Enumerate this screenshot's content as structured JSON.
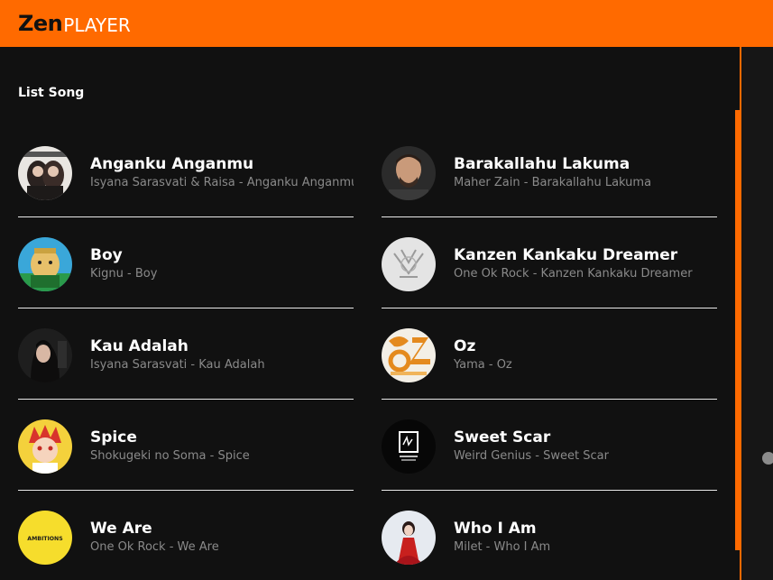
{
  "app": {
    "brand_main": "Zen",
    "brand_sub": "PLAYER"
  },
  "section": {
    "title": "List Song"
  },
  "songs": [
    {
      "title": "Anganku Anganmu",
      "subtitle": "Isyana Sarasvati & Raisa - Anganku Anganmu",
      "cover_icon": "album-art-duo-icon"
    },
    {
      "title": "Barakallahu Lakuma",
      "subtitle": "Maher Zain - Barakallahu Lakuma",
      "cover_icon": "album-art-portrait-icon"
    },
    {
      "title": "Boy",
      "subtitle": "Kignu - Boy",
      "cover_icon": "album-art-cartoon-icon"
    },
    {
      "title": "Kanzen Kankaku Dreamer",
      "subtitle": "One Ok Rock - Kanzen Kankaku Dreamer",
      "cover_icon": "album-art-sketch-icon"
    },
    {
      "title": "Kau Adalah",
      "subtitle": "Isyana Sarasvati - Kau Adalah",
      "cover_icon": "album-art-portrait-icon"
    },
    {
      "title": "Oz",
      "subtitle": "Yama - Oz",
      "cover_icon": "album-art-abstract-icon"
    },
    {
      "title": "Spice",
      "subtitle": "Shokugeki no Soma - Spice",
      "cover_icon": "album-art-anime-icon"
    },
    {
      "title": "Sweet Scar",
      "subtitle": "Weird Genius - Sweet Scar",
      "cover_icon": "album-art-logo-icon"
    },
    {
      "title": "We Are",
      "subtitle": "One Ok Rock - We Are",
      "cover_icon": "album-art-ambitions-icon",
      "cover_text": "AMBITIONS"
    },
    {
      "title": "Who I Am",
      "subtitle": "Milet - Who I Am",
      "cover_icon": "album-art-portrait-icon"
    }
  ],
  "colors": {
    "accent": "#ff6a00",
    "background": "#111111",
    "text": "#ffffff",
    "muted": "#8a8a8a"
  }
}
